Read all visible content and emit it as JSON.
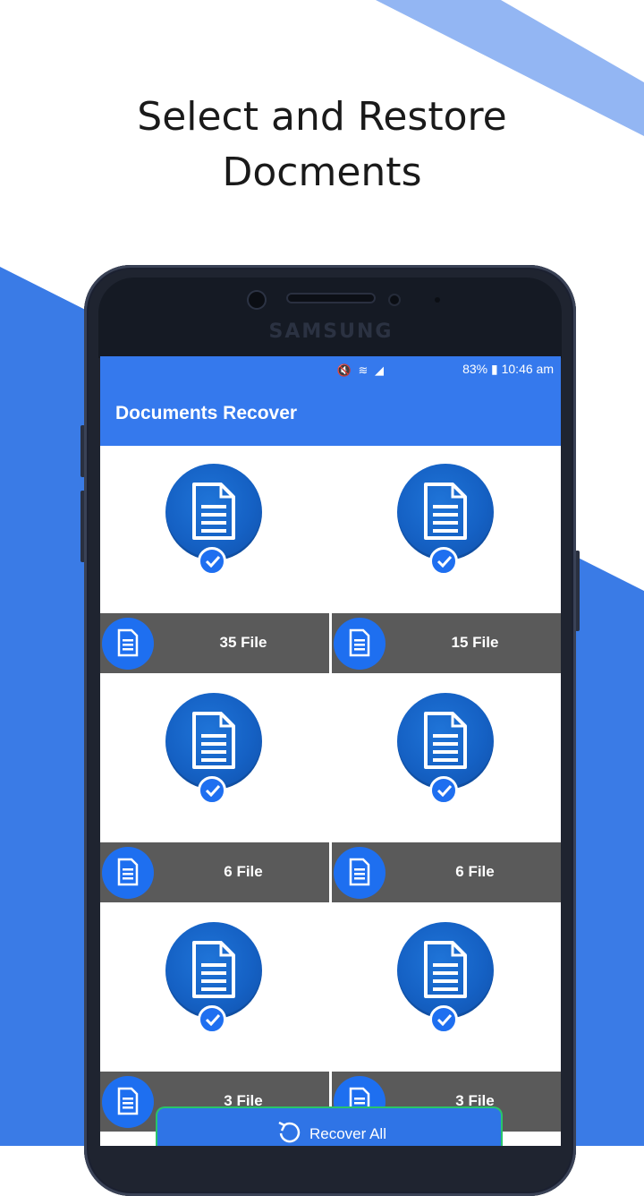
{
  "headline": {
    "line1": "Select and Restore",
    "line2": "Docments"
  },
  "device": {
    "brand": "SAMSUNG"
  },
  "status_bar": {
    "icons_text": "🔇 ≋ ◢",
    "battery_and_time": "83% ▮ 10:46 am"
  },
  "app": {
    "title": "Documents Recover"
  },
  "folders": [
    {
      "count_label": "35 File",
      "selected": true
    },
    {
      "count_label": "15 File",
      "selected": true
    },
    {
      "count_label": "6 File",
      "selected": true
    },
    {
      "count_label": "6 File",
      "selected": true
    },
    {
      "count_label": "3 File",
      "selected": true
    },
    {
      "count_label": "3 File",
      "selected": true
    }
  ],
  "recover_button": {
    "label": "Recover All"
  },
  "colors": {
    "primary": "#3579ed",
    "background_blue": "#3a7be6",
    "light_blue_stripe": "#93b6f3",
    "folder_bar": "#5a5a5a",
    "icon_circle": "#1561c4",
    "button_border": "#29c46a"
  }
}
